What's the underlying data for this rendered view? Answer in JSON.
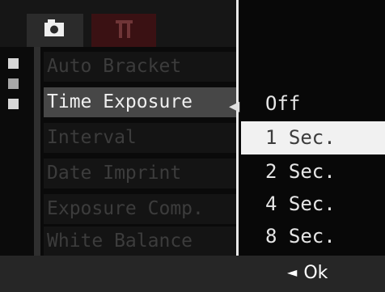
{
  "tabs": [
    {
      "icon": "camera-icon",
      "label": ""
    },
    {
      "icon": "setup-icon",
      "label": ""
    }
  ],
  "menu": {
    "items": [
      {
        "label": "Auto Bracket",
        "state": "dimmed"
      },
      {
        "label": "Time Exposure",
        "state": "selected"
      },
      {
        "label": "Interval",
        "state": "dimmed"
      },
      {
        "label": "Date Imprint",
        "state": "dimmed"
      },
      {
        "label": "Exposure Comp.",
        "state": "dimmed"
      },
      {
        "label": "White Balance",
        "state": "dimmed"
      }
    ]
  },
  "submenu": {
    "options": [
      "Off",
      "1 Sec.",
      "2 Sec.",
      "4 Sec.",
      "8 Sec."
    ],
    "highlighted": "1 Sec."
  },
  "footer": {
    "hint_arrow": "◄",
    "hint_label": "Ok"
  },
  "colors": {
    "selected_bg": "#474747",
    "highlight_bg": "#f1f1f1",
    "footer_bg": "#262626"
  }
}
